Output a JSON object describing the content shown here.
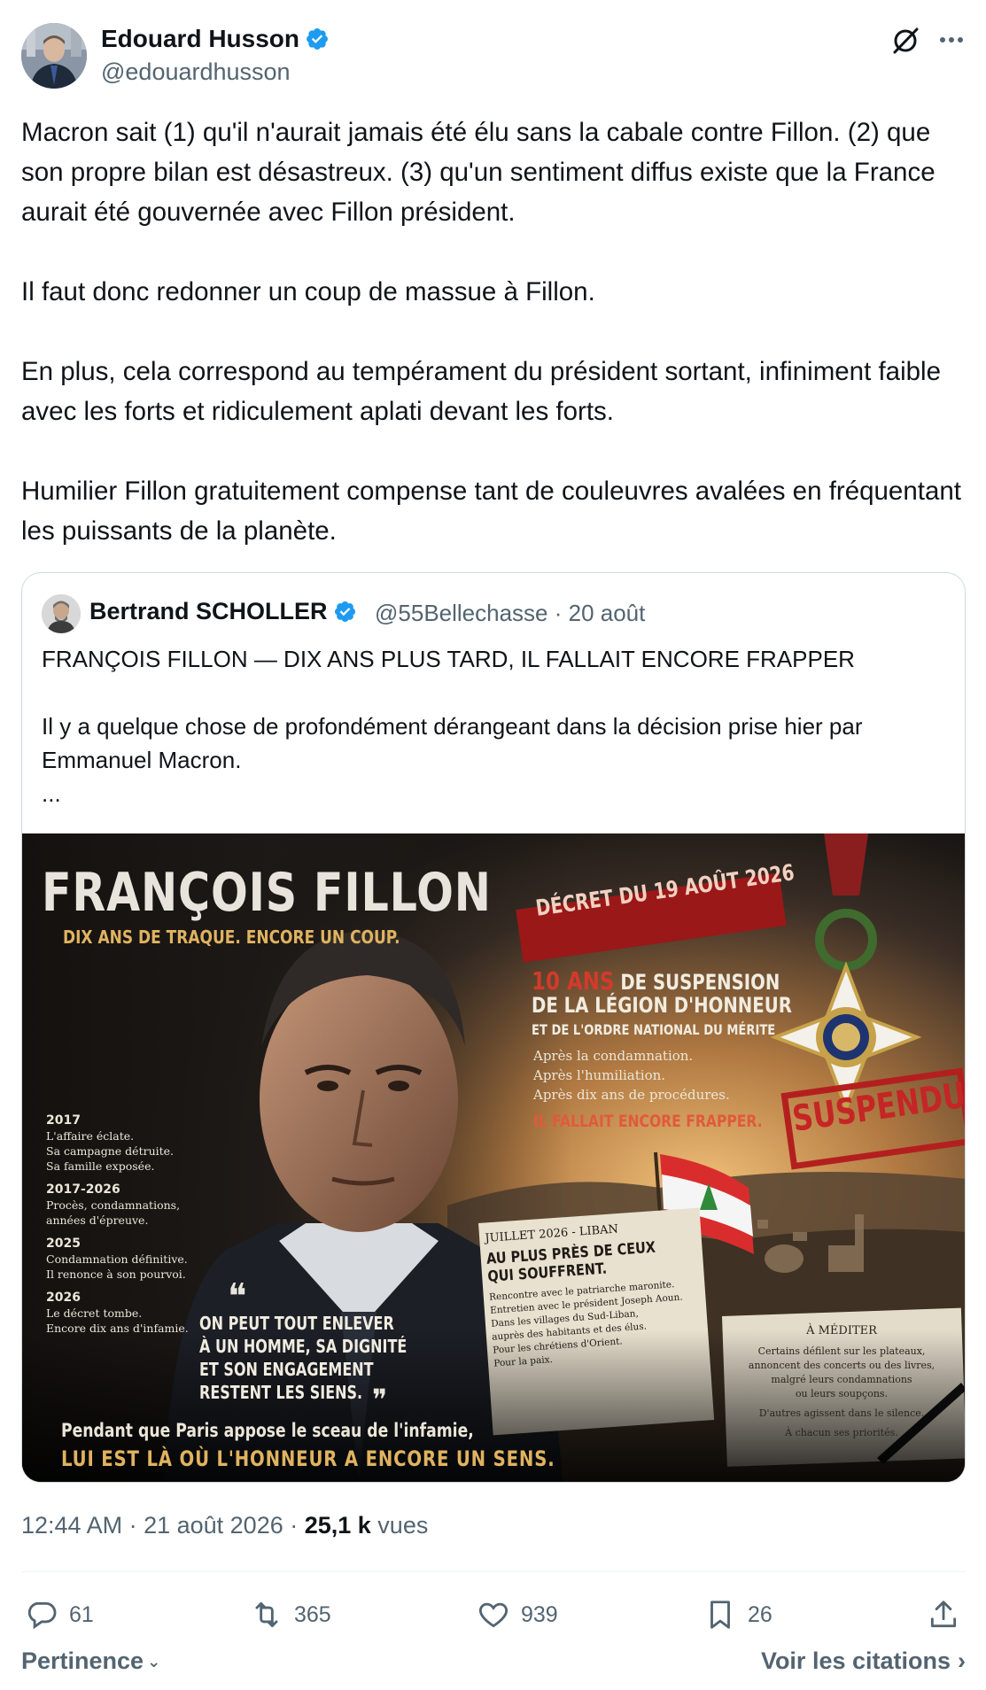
{
  "author": {
    "name": "Edouard Husson",
    "handle": "@edouardhusson"
  },
  "body": {
    "paragraphs": [
      "Macron sait (1) qu'il n'aurait jamais été élu sans la cabale contre Fillon. (2) que son propre bilan est désastreux. (3) qu'un sentiment diffus existe que la France aurait été gouvernée avec Fillon président.",
      "Il faut donc redonner un coup de massue à Fillon.",
      "En plus, cela correspond au tempérament du président sortant, infiniment faible avec les forts et ridiculement aplati devant les forts.",
      "Humilier Fillon gratuitement compense tant de couleuvres avalées en fréquentant les puissants de la planète."
    ]
  },
  "quote": {
    "name": "Bertrand SCHOLLER",
    "handle_date": "@55Bellechasse · 20 août",
    "headline": "FRANÇOIS FILLON — DIX ANS PLUS TARD, IL FALLAIT ENCORE FRAPPER",
    "text": "Il y a quelque chose de profondément dérangeant dans la décision prise hier par Emmanuel Macron.",
    "ellipsis": "...",
    "poster": {
      "title": "FRANÇOIS FILLON",
      "subtitle": "DIX ANS DE TRAQUE. ENCORE UN COUP.",
      "decree": "DÉCRET DU 19 AOÛT 2026",
      "susp_years": "10 ANS",
      "susp_line1": "DE SUSPENSION",
      "susp_line2": "DE LA LÉGION D'HONNEUR",
      "susp_line3": "ET DE L'ORDRE NATIONAL DU MÉRITE",
      "after_lines": [
        "Après la condamnation.",
        "Après l'humiliation.",
        "Après dix ans de procédures."
      ],
      "strike": "IL FALLAIT ENCORE FRAPPER.",
      "stamp": "SUSPENDU",
      "timeline": [
        {
          "year": "2017",
          "lines": [
            "L'affaire éclate.",
            "Sa campagne détruite.",
            "Sa famille exposée."
          ]
        },
        {
          "year": "2017-2026",
          "lines": [
            "Procès, condamnations,",
            "années d'épreuve."
          ]
        },
        {
          "year": "2025",
          "lines": [
            "Condamnation définitive.",
            "Il renonce à son pourvoi."
          ]
        },
        {
          "year": "2026",
          "lines": [
            "Le décret tombe.",
            "Encore dix ans d'infamie."
          ]
        }
      ],
      "quote_lines": [
        "ON PEUT TOUT ENLEVER",
        "À UN HOMME, SA DIGNITÉ",
        "ET SON ENGAGEMENT",
        "RESTENT LES SIENS."
      ],
      "liban_tag": "JUILLET 2026 - LIBAN",
      "liban_title": [
        "AU PLUS PRÈS DE CEUX",
        "QUI SOUFFRENT."
      ],
      "liban_lines": [
        "Rencontre avec le patriarche maronite.",
        "Entretien avec le président Joseph Aoun.",
        "Dans les villages du Sud-Liban,",
        "auprès des habitants et des élus.",
        "Pour les chrétiens d'Orient.",
        "Pour la paix."
      ],
      "mediter_title": "À MÉDITER",
      "mediter_lines": [
        "Certains défilent sur les plateaux,",
        "annoncent des concerts ou des livres,",
        "malgré leurs condamnations",
        "ou leurs soupçons.",
        "D'autres agissent dans le silence.",
        "À chacun ses priorités."
      ],
      "bottom_line1": "Pendant que Paris appose le sceau de l'infamie,",
      "bottom_line2": "LUI EST LÀ OÙ L'HONNEUR A ENCORE UN SENS."
    }
  },
  "meta": {
    "time_date": "12:44 AM · 21 août 2026 · ",
    "views_count": "25,1 k",
    "views_label": " vues"
  },
  "actions": {
    "replies": "61",
    "retweets": "365",
    "likes": "939",
    "bookmarks": "26"
  },
  "footer": {
    "sort_label": "Pertinence",
    "quotes_link": "Voir les citations"
  },
  "colors": {
    "verified": "#1d9bf0",
    "secondary_text": "#536471",
    "primary_text": "#0f1419",
    "border": "#cfd9de"
  }
}
